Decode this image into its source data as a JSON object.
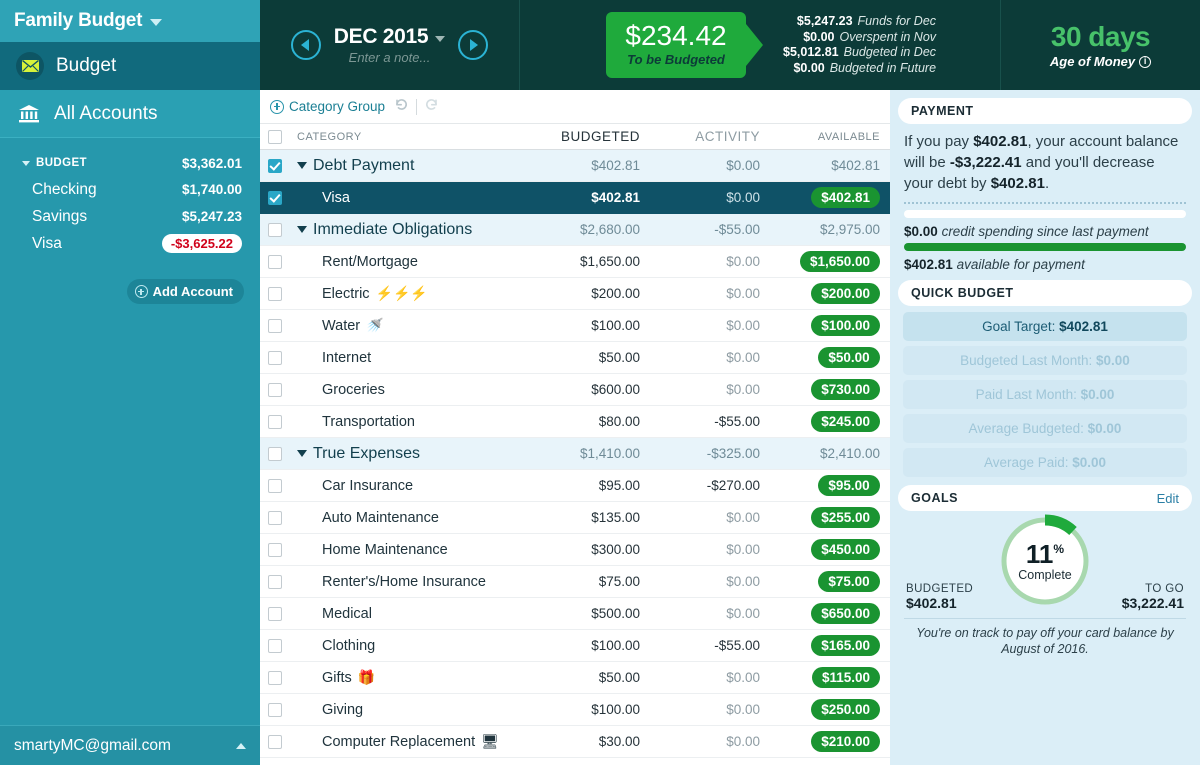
{
  "sidebar": {
    "budget_name": "Family Budget",
    "nav": [
      {
        "label": "Budget",
        "icon": "envelope-icon"
      },
      {
        "label": "All Accounts",
        "icon": "bank-icon"
      }
    ],
    "account_group": {
      "label": "BUDGET",
      "amount": "$3,362.01"
    },
    "accounts": [
      {
        "label": "Checking",
        "amount": "$1,740.00",
        "negative": false
      },
      {
        "label": "Savings",
        "amount": "$5,247.23",
        "negative": false
      },
      {
        "label": "Visa",
        "amount": "-$3,625.22",
        "negative": true
      }
    ],
    "add_account_label": "Add Account",
    "user_email": "smartyMC@gmail.com"
  },
  "topbar": {
    "month": "DEC 2015",
    "note_placeholder": "Enter a note...",
    "to_be_budgeted_amount": "$234.42",
    "to_be_budgeted_label": "To be Budgeted",
    "stats": [
      {
        "value": "$5,247.23",
        "label": "Funds for Dec"
      },
      {
        "value": "$0.00",
        "label": "Overspent in Nov"
      },
      {
        "value": "$5,012.81",
        "label": "Budgeted in Dec"
      },
      {
        "value": "$0.00",
        "label": "Budgeted in Future"
      }
    ],
    "age_of_money_value": "30 days",
    "age_of_money_label": "Age of Money"
  },
  "budget_table": {
    "toolbar": {
      "category_group_label": "Category Group"
    },
    "columns": [
      "CATEGORY",
      "BUDGETED",
      "ACTIVITY",
      "AVAILABLE"
    ],
    "rows": [
      {
        "type": "group",
        "name": "Debt Payment",
        "budgeted": "$402.81",
        "activity": "$0.00",
        "available": "$402.81",
        "checked": true,
        "selected": false,
        "emoji": ""
      },
      {
        "type": "child",
        "name": "Visa",
        "budgeted": "$402.81",
        "activity": "$0.00",
        "available": "$402.81",
        "checked": true,
        "selected": true,
        "emoji": ""
      },
      {
        "type": "group",
        "name": "Immediate Obligations",
        "budgeted": "$2,680.00",
        "activity": "-$55.00",
        "available": "$2,975.00",
        "checked": false,
        "selected": false,
        "emoji": ""
      },
      {
        "type": "child",
        "name": "Rent/Mortgage",
        "budgeted": "$1,650.00",
        "activity": "$0.00",
        "available": "$1,650.00",
        "checked": false,
        "selected": false,
        "emoji": ""
      },
      {
        "type": "child",
        "name": "Electric",
        "budgeted": "$200.00",
        "activity": "$0.00",
        "available": "$200.00",
        "checked": false,
        "selected": false,
        "emoji": "⚡⚡⚡"
      },
      {
        "type": "child",
        "name": "Water",
        "budgeted": "$100.00",
        "activity": "$0.00",
        "available": "$100.00",
        "checked": false,
        "selected": false,
        "emoji": "🚿"
      },
      {
        "type": "child",
        "name": "Internet",
        "budgeted": "$50.00",
        "activity": "$0.00",
        "available": "$50.00",
        "checked": false,
        "selected": false,
        "emoji": ""
      },
      {
        "type": "child",
        "name": "Groceries",
        "budgeted": "$600.00",
        "activity": "$0.00",
        "available": "$730.00",
        "checked": false,
        "selected": false,
        "emoji": ""
      },
      {
        "type": "child",
        "name": "Transportation",
        "budgeted": "$80.00",
        "activity": "-$55.00",
        "available": "$245.00",
        "checked": false,
        "selected": false,
        "emoji": ""
      },
      {
        "type": "group",
        "name": "True Expenses",
        "budgeted": "$1,410.00",
        "activity": "-$325.00",
        "available": "$2,410.00",
        "checked": false,
        "selected": false,
        "emoji": ""
      },
      {
        "type": "child",
        "name": "Car Insurance",
        "budgeted": "$95.00",
        "activity": "-$270.00",
        "available": "$95.00",
        "checked": false,
        "selected": false,
        "emoji": ""
      },
      {
        "type": "child",
        "name": "Auto Maintenance",
        "budgeted": "$135.00",
        "activity": "$0.00",
        "available": "$255.00",
        "checked": false,
        "selected": false,
        "emoji": ""
      },
      {
        "type": "child",
        "name": "Home Maintenance",
        "budgeted": "$300.00",
        "activity": "$0.00",
        "available": "$450.00",
        "checked": false,
        "selected": false,
        "emoji": ""
      },
      {
        "type": "child",
        "name": "Renter's/Home Insurance",
        "budgeted": "$75.00",
        "activity": "$0.00",
        "available": "$75.00",
        "checked": false,
        "selected": false,
        "emoji": ""
      },
      {
        "type": "child",
        "name": "Medical",
        "budgeted": "$500.00",
        "activity": "$0.00",
        "available": "$650.00",
        "checked": false,
        "selected": false,
        "emoji": ""
      },
      {
        "type": "child",
        "name": "Clothing",
        "budgeted": "$100.00",
        "activity": "-$55.00",
        "available": "$165.00",
        "checked": false,
        "selected": false,
        "emoji": ""
      },
      {
        "type": "child",
        "name": "Gifts",
        "budgeted": "$50.00",
        "activity": "$0.00",
        "available": "$115.00",
        "checked": false,
        "selected": false,
        "emoji": "🎁"
      },
      {
        "type": "child",
        "name": "Giving",
        "budgeted": "$100.00",
        "activity": "$0.00",
        "available": "$250.00",
        "checked": false,
        "selected": false,
        "emoji": ""
      },
      {
        "type": "child",
        "name": "Computer Replacement",
        "budgeted": "$30.00",
        "activity": "$0.00",
        "available": "$210.00",
        "checked": false,
        "selected": false,
        "emoji": "🖥"
      }
    ]
  },
  "inspector": {
    "payment": {
      "title": "PAYMENT",
      "text_a": "If you pay ",
      "amount_pay": "$402.81",
      "text_b": ", your account balance will be ",
      "amount_balance": "-$3,222.41",
      "text_c": " and you'll decrease your debt by ",
      "amount_debt": "$402.81",
      "text_d": ".",
      "credit_spending_amount": "$0.00",
      "credit_spending_label": "credit spending since last payment",
      "available_amount": "$402.81",
      "available_label": "available for payment"
    },
    "quick_budget": {
      "title": "QUICK BUDGET",
      "options": [
        {
          "label": "Goal Target: ",
          "value": "$402.81",
          "primary": true
        },
        {
          "label": "Budgeted Last Month: ",
          "value": "$0.00",
          "primary": false
        },
        {
          "label": "Paid Last Month: ",
          "value": "$0.00",
          "primary": false
        },
        {
          "label": "Average Budgeted: ",
          "value": "$0.00",
          "primary": false
        },
        {
          "label": "Average Paid: ",
          "value": "$0.00",
          "primary": false
        }
      ]
    },
    "goals": {
      "title": "GOALS",
      "edit_label": "Edit",
      "percent": "11",
      "percent_symbol": "%",
      "complete_label": "Complete",
      "budgeted_label": "BUDGETED",
      "budgeted_value": "$402.81",
      "togo_label": "TO GO",
      "togo_value": "$3,222.41",
      "note": "You're on track to pay off your card balance by August of 2016."
    }
  },
  "colors": {
    "sidebar": "#2698ac",
    "topbar": "#0c3b38",
    "accent_green": "#1faa3c",
    "pill_green": "#1a9431",
    "selected_row": "#0f5267",
    "inspector_bg": "#dbeef7",
    "negative_red": "#d0021b"
  }
}
